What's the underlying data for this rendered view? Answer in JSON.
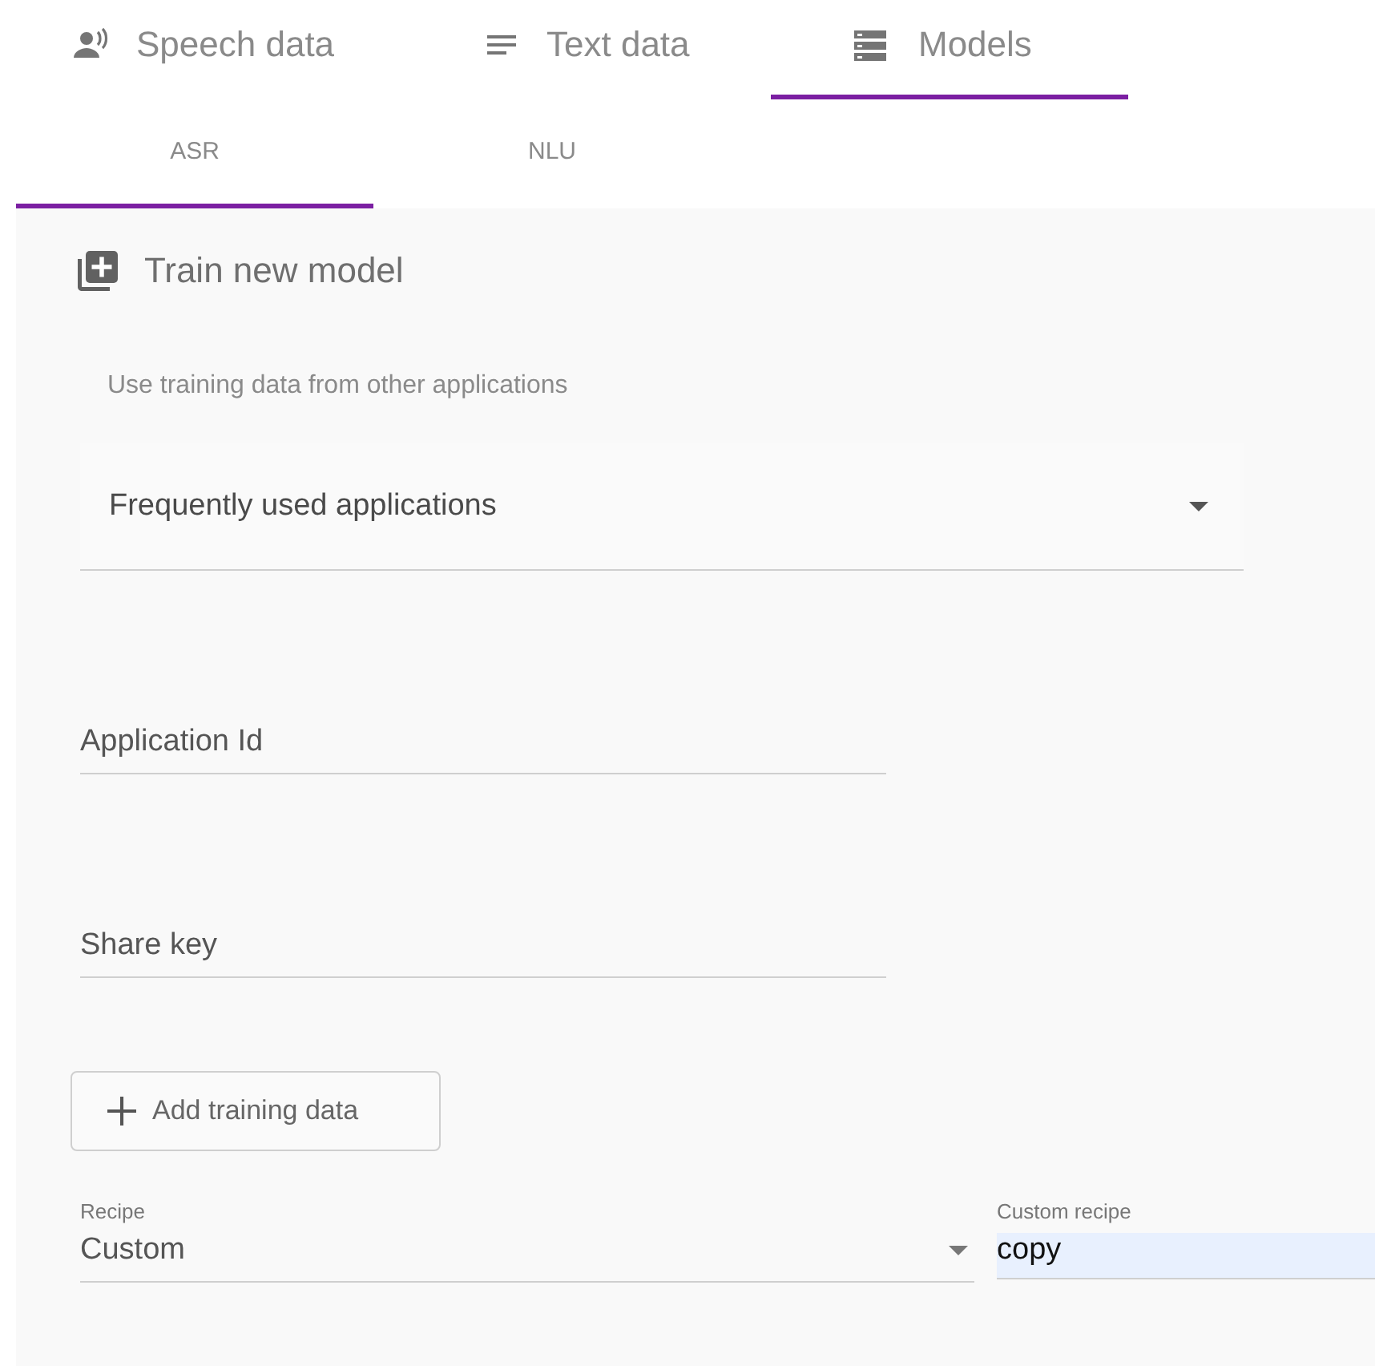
{
  "tabs": [
    {
      "label": "Speech data",
      "selected": false
    },
    {
      "label": "Text data",
      "selected": false
    },
    {
      "label": "Models",
      "selected": true
    }
  ],
  "subtabs": [
    {
      "label": "ASR",
      "selected": true
    },
    {
      "label": "NLU",
      "selected": false
    }
  ],
  "panel": {
    "title": "Train new model",
    "source_label": "Use training data from other applications",
    "source_select": {
      "value": "Frequently used applications"
    },
    "application_id": {
      "placeholder": "Application Id"
    },
    "share_key": {
      "placeholder": "Share key"
    },
    "add_button": "Add training data",
    "recipe": {
      "label": "Recipe",
      "value": "Custom"
    },
    "custom_recipe": {
      "label": "Custom recipe",
      "value": "copy"
    }
  }
}
